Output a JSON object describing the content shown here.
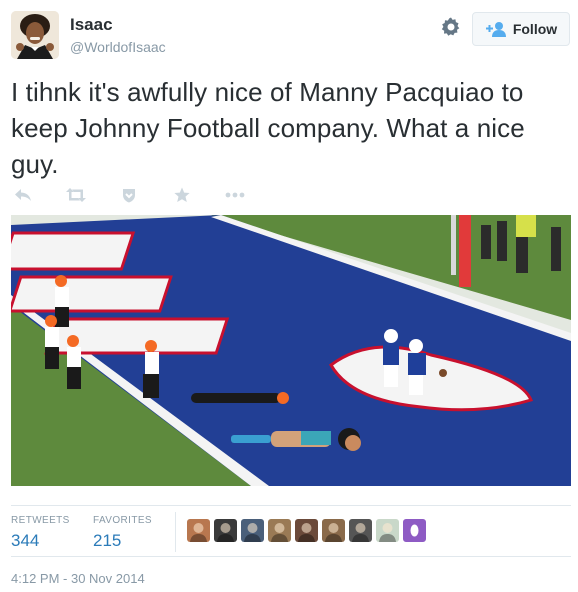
{
  "header": {
    "display_name": "Isaac",
    "handle": "@WorldofIsaac",
    "follow_label": "Follow"
  },
  "tweet": {
    "text": "I tihnk it's awfully nice of Manny Pacquiao to keep Johnny Football company. What a nice guy."
  },
  "actions": [
    "reply-icon",
    "retweet-icon",
    "favorite-shield-icon",
    "star-icon",
    "more-icon"
  ],
  "stats": {
    "retweets_label": "RETWEETS",
    "retweets_value": "344",
    "favorites_label": "FAVORITES",
    "favorites_value": "215"
  },
  "favoriters": {
    "count": 9,
    "colors": [
      "#b8774f",
      "#3a3a3a",
      "#4a5f7a",
      "#9a7a55",
      "#6b4a3a",
      "#8a6a4a",
      "#555555",
      "#c9d8c9",
      "#8e5bc4"
    ]
  },
  "timestamp": "4:12 PM - 30 Nov 2014",
  "colors": {
    "link": "#2b7bb9",
    "muted": "#8899a6",
    "text": "#292f33",
    "field_green": "#5e8a3d",
    "endzone_blue": "#223f95"
  }
}
